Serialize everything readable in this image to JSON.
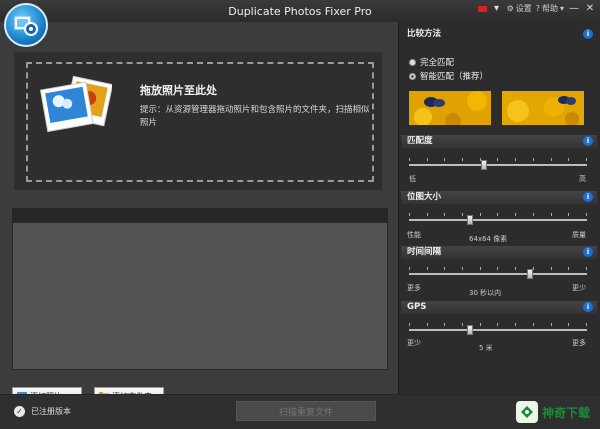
{
  "window": {
    "title": "Duplicate Photos Fixer Pro",
    "minimize": "—",
    "close": "✕"
  },
  "topbar": {
    "settings": "设置",
    "help": "帮助"
  },
  "drop_zone": {
    "title": "拖放照片至此处",
    "hint": "提示：从资源管理器拖动照片和包含照片的文件夹，扫描相似照片"
  },
  "buttons": {
    "add_photos": "添加照片",
    "add_folder": "添加文件夹",
    "scan": "扫描重复文件"
  },
  "status": {
    "registered": "已注册版本"
  },
  "watermark": {
    "text": "神奇下载"
  },
  "sidebar": {
    "compare_title": "比较方法",
    "options": [
      {
        "label": "完全匹配",
        "selected": false
      },
      {
        "label": "智能匹配（推荐）",
        "selected": true
      }
    ],
    "match_level": {
      "title": "匹配度",
      "min_label": "低",
      "max_label": "高",
      "value": 0.42
    },
    "bitmap_size": {
      "title": "位图大小",
      "min_label": "性能",
      "max_label": "质量",
      "value_label": "64x64 像素",
      "value": 0.34
    },
    "time_interval": {
      "title": "时间间隔",
      "min_label": "更多",
      "max_label": "更少",
      "value_label": "30 秒以内",
      "value": 0.68
    },
    "gps": {
      "title": "GPS",
      "min_label": "更少",
      "max_label": "更多",
      "value_label": "5 米",
      "value": 0.34
    }
  },
  "colors": {
    "accent": "#1e6fd0",
    "brand_green": "#1d8a3a"
  },
  "icons": {
    "logo": "gear-photo-icon",
    "info": "info-icon",
    "add_photo": "image-icon",
    "add_folder": "folder-icon",
    "registered": "check-icon"
  }
}
